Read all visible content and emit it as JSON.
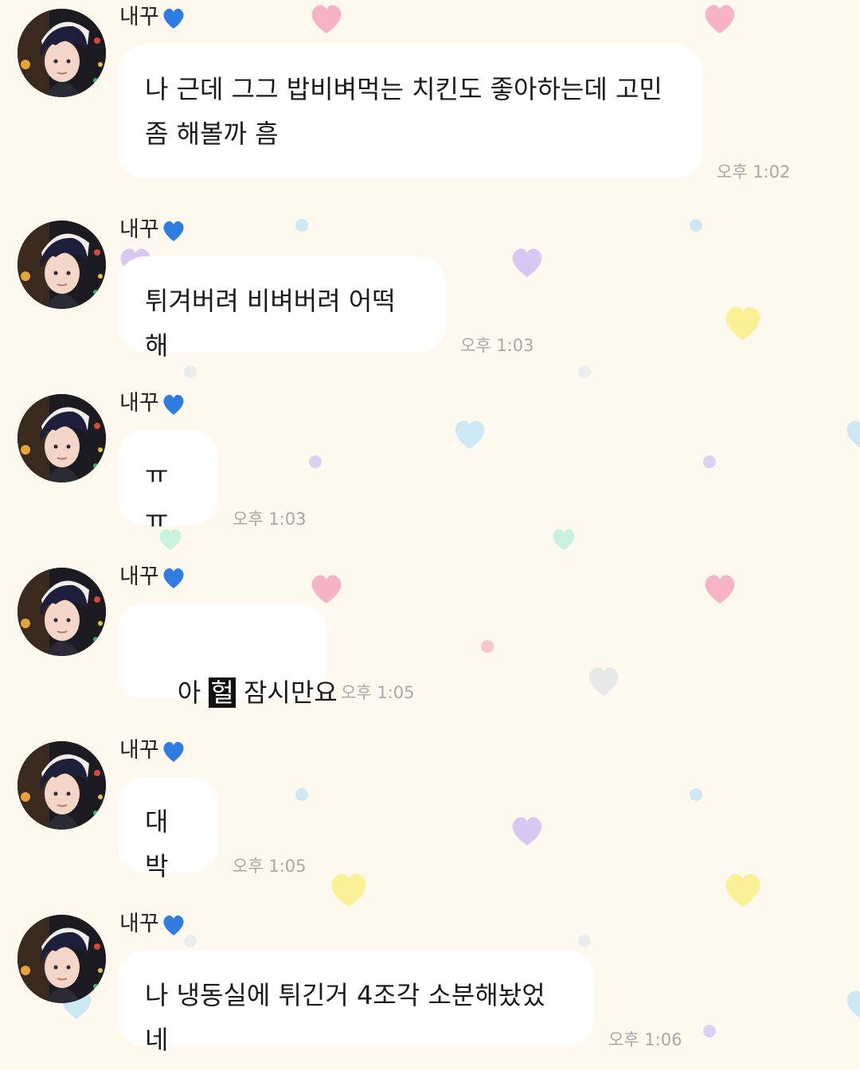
{
  "chat": {
    "messages": [
      {
        "sender": "내꾸",
        "text_lines": [
          "나 근데 그그 밥비벼먹는 치킨도 좋아하는데 고민",
          "좀 해볼까 흠"
        ],
        "time": "오후 1:02"
      },
      {
        "sender": "내꾸",
        "text_lines": [
          "튀겨버려 비벼버려 어떡해"
        ],
        "time": "오후 1:03"
      },
      {
        "sender": "내꾸",
        "text_lines": [
          "ㅠㅠ"
        ],
        "time": "오후 1:03"
      },
      {
        "sender": "내꾸",
        "text_before": "아 ",
        "text_highlight": "헐",
        "text_after": " 잠시만요",
        "time": "오후 1:05"
      },
      {
        "sender": "내꾸",
        "text_lines": [
          "대박"
        ],
        "time": "오후 1:05"
      },
      {
        "sender": "내꾸",
        "text_lines": [
          "나 냉동실에 튀긴거 4조각 소분해놨었네"
        ],
        "time": "오후 1:06"
      }
    ]
  },
  "icons": {
    "sender_suffix": "blue-heart-icon",
    "avatar": "avatar-illustration"
  },
  "colors": {
    "background": "#fdf9ee",
    "bubble": "#ffffff",
    "time_text": "#a8a8a8",
    "highlight": "#111111"
  }
}
